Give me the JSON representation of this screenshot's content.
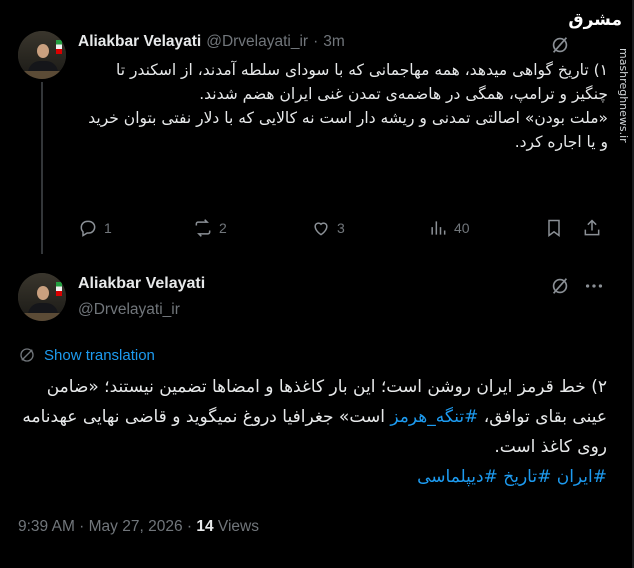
{
  "watermark": {
    "logo_text": "مشرق",
    "site": "mashreghnews.ir"
  },
  "tweet1": {
    "author_name": "Aliakbar Velayati",
    "handle": "@Drvelayati_ir",
    "separator": "·",
    "time": "3m",
    "body": [
      "۱) تاریخ گواهی میدهد، همه مهاجمانی که با سودای سلطه آمدند، از اسکندر تا چنگیز و ترامپ، همگی در هاضمه‌ی تمدن غنی ایران هضم شدند.",
      "«ملت بودن» اصالتی تمدنی و ریشه دار است نه کالایی که با دلار نفتی بتوان خرید و یا اجاره کرد."
    ],
    "replies": "1",
    "reposts": "2",
    "likes": "3",
    "views": "40"
  },
  "tweet2": {
    "author_name": "Aliakbar Velayati",
    "handle": "@Drvelayati_ir",
    "show_translation": "Show translation",
    "body_line1": "۲) خط قرمز ایران روشن است؛ این بار کاغذها و امضاها تضمین نیستند؛ «ضامن عینی بقای توافق، ",
    "hashtag_hormuz": "#تنگه_هرمز",
    "body_line1b": " است» جغرافیا دروغ نمیگوید و قاضی نهایی عهدنامه روی کاغذ است.",
    "hashtags": "#ایران #تاریخ #دیپلماسی",
    "timestamp": "9:39 AM · May 27, 2026 · ",
    "views_count": "14",
    "views_label": " Views"
  },
  "colors": {
    "background": "#000000",
    "text": "#e7e9ea",
    "muted": "#71767b",
    "accent": "#1d9bf0",
    "divider": "#333639"
  },
  "icons": [
    "grok-icon",
    "more-icon",
    "reply-icon",
    "repost-icon",
    "like-icon",
    "views-icon",
    "bookmark-icon",
    "share-icon",
    "translate-icon"
  ]
}
